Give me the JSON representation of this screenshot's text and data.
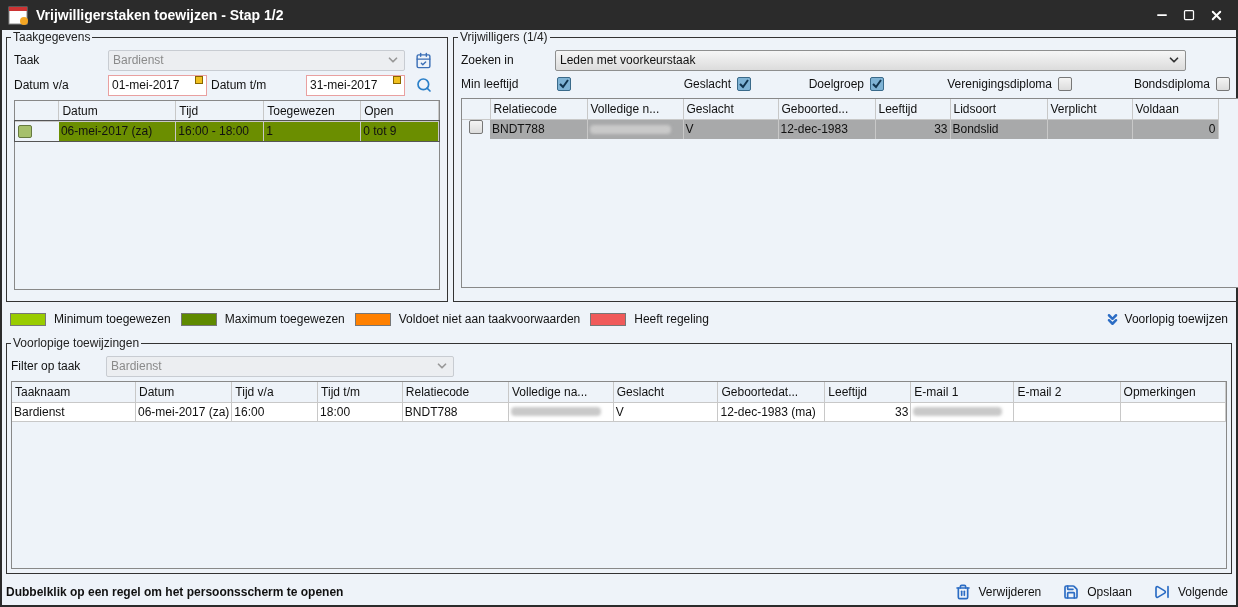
{
  "window": {
    "title": "Vrijwilligerstaken toewijzen - Stap 1/2"
  },
  "task_panel": {
    "legend": "Taakgegevens",
    "task_label": "Taak",
    "task_value": "Bardienst",
    "from_label": "Datum v/a",
    "from_value": "01-mei-2017",
    "to_label": "Datum t/m",
    "to_value": "31-mei-2017",
    "columns": [
      "Datum",
      "Tijd",
      "Toegewezen",
      "Open"
    ],
    "rows": [
      {
        "color": "#6b8e00",
        "selected": true,
        "cells": [
          "06-mei-2017 (za)",
          "16:00 - 18:00",
          "1",
          "0 tot 9"
        ]
      }
    ]
  },
  "volunteers_panel": {
    "legend": "Vrijwilligers (1/4)",
    "search_label": "Zoeken in",
    "search_value": "Leden met voorkeurstaak",
    "filters": [
      {
        "label": "Min leeftijd",
        "checked": true
      },
      {
        "label": "Geslacht",
        "checked": true
      },
      {
        "label": "Doelgroep",
        "checked": true
      },
      {
        "label": "Verenigingsdiploma",
        "checked": false
      },
      {
        "label": "Bondsdiploma",
        "checked": false
      }
    ],
    "columns": [
      {
        "label": "Relatiecode",
        "kind": "text"
      },
      {
        "label": "Volledige n...",
        "kind": "text"
      },
      {
        "label": "Geslacht",
        "kind": "text"
      },
      {
        "label": "Geboorted...",
        "kind": "text"
      },
      {
        "label": "Leeftijd",
        "kind": "number"
      },
      {
        "label": "Lidsoort",
        "kind": "text"
      },
      {
        "label": "Verplicht",
        "kind": "text"
      },
      {
        "label": "Voldaan",
        "kind": "number"
      }
    ],
    "rows": [
      {
        "selected": true,
        "checked": false,
        "cells": [
          "BNDT788",
          null,
          "V",
          "12-dec-1983",
          "33",
          "Bondslid",
          "",
          "0"
        ]
      }
    ]
  },
  "legend_items": [
    {
      "label": "Minimum toegewezen",
      "color": "#99cc00"
    },
    {
      "label": "Maximum toegewezen",
      "color": "#5f8a00"
    },
    {
      "label": "Voldoet niet aan taakvoorwaarden",
      "color": "#ff8000"
    },
    {
      "label": "Heeft regeling",
      "color": "#f05a5a"
    }
  ],
  "assign_button": "Voorlopig toewijzen",
  "assignments_panel": {
    "legend": "Voorlopige toewijzingen",
    "filter_label": "Filter op taak",
    "filter_value": "Bardienst",
    "columns": [
      {
        "label": "Taaknaam",
        "kind": "text"
      },
      {
        "label": "Datum",
        "kind": "text"
      },
      {
        "label": "Tijd v/a",
        "kind": "text"
      },
      {
        "label": "Tijd t/m",
        "kind": "text"
      },
      {
        "label": "Relatiecode",
        "kind": "text"
      },
      {
        "label": "Volledige na...",
        "kind": "text"
      },
      {
        "label": "Geslacht",
        "kind": "text"
      },
      {
        "label": "Geboortedat...",
        "kind": "text"
      },
      {
        "label": "Leeftijd",
        "kind": "number"
      },
      {
        "label": "E-mail 1",
        "kind": "text"
      },
      {
        "label": "E-mail 2",
        "kind": "text"
      },
      {
        "label": "Opmerkingen",
        "kind": "text"
      }
    ],
    "rows": [
      {
        "cells": [
          "Bardienst",
          "06-mei-2017 (za)",
          "16:00",
          "18:00",
          "BNDT788",
          null,
          "V",
          "12-dec-1983 (ma)",
          "33",
          null,
          "",
          ""
        ]
      }
    ]
  },
  "status_bar": {
    "hint": "Dubbelklik op een regel om het persoonsscherm te openen",
    "buttons": [
      {
        "label": "Verwijderen",
        "kind": "delete"
      },
      {
        "label": "Opslaan",
        "kind": "save"
      },
      {
        "label": "Volgende",
        "kind": "next"
      }
    ]
  }
}
